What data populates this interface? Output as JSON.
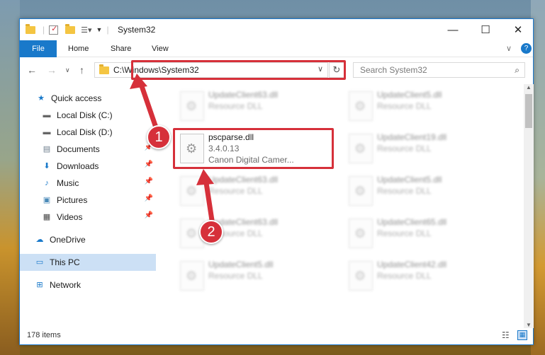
{
  "window": {
    "title": "System32",
    "controls": {
      "minimize": "—",
      "maximize": "☐",
      "close": "✕"
    }
  },
  "ribbon": {
    "file": "File",
    "tabs": [
      "Home",
      "Share",
      "View"
    ]
  },
  "address": {
    "path": "C:\\Windows\\System32",
    "search_placeholder": "Search System32"
  },
  "nav": {
    "items": [
      {
        "label": "Quick access",
        "icon": "star-icon",
        "pinned": false
      },
      {
        "label": "Local Disk (C:)",
        "icon": "drive-icon",
        "pinned": false
      },
      {
        "label": "Local Disk (D:)",
        "icon": "drive-icon",
        "pinned": false
      },
      {
        "label": "Documents",
        "icon": "documents-icon",
        "pinned": true
      },
      {
        "label": "Downloads",
        "icon": "download-icon",
        "pinned": true
      },
      {
        "label": "Music",
        "icon": "music-icon",
        "pinned": true
      },
      {
        "label": "Pictures",
        "icon": "pictures-icon",
        "pinned": true
      },
      {
        "label": "Videos",
        "icon": "videos-icon",
        "pinned": true
      },
      {
        "label": "OneDrive",
        "icon": "cloud-icon",
        "pinned": false
      },
      {
        "label": "This PC",
        "icon": "computer-icon",
        "pinned": false
      },
      {
        "label": "Network",
        "icon": "network-icon",
        "pinned": false
      }
    ]
  },
  "files": {
    "highlighted": {
      "name": "pscparse.dll",
      "version": "3.4.0.13",
      "description": "Canon Digital Camer..."
    },
    "left_column": [
      {
        "name": "UpdateClient63.dll",
        "type": "Resource DLL"
      },
      {
        "name": "UpdateClient63.dll",
        "type": "Resource DLL"
      },
      {
        "name": "UpdateClient63.dll",
        "type": "Resource DLL"
      },
      {
        "name": "UpdateClient5.dll",
        "type": "Resource DLL"
      }
    ],
    "right_column": [
      {
        "name": "UpdateClient5.dll",
        "type": "Resource DLL"
      },
      {
        "name": "UpdateClient19.dll",
        "type": "Resource DLL"
      },
      {
        "name": "UpdateClient5.dll",
        "type": "Resource DLL"
      },
      {
        "name": "UpdateClient65.dll",
        "type": "Resource DLL"
      },
      {
        "name": "UpdateClient42.dll",
        "type": "Resource DLL"
      }
    ]
  },
  "status": {
    "items": "178 items"
  },
  "markers": {
    "first": "1",
    "second": "2"
  },
  "colors": {
    "accent": "#1979ca",
    "highlight": "#d6303a",
    "selection": "#cce0f5"
  }
}
